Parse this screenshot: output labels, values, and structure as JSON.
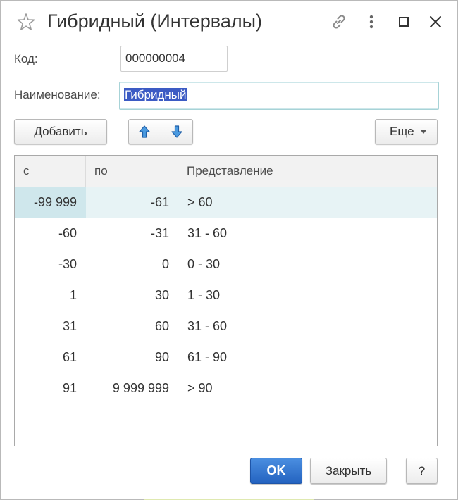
{
  "window": {
    "title": "Гибридный (Интервалы)",
    "icons": [
      "star-icon",
      "link-icon",
      "more-vertical-icon",
      "maximize-icon",
      "close-icon"
    ]
  },
  "form": {
    "code_label": "Код:",
    "code_value": "000000004",
    "name_label": "Наименование:",
    "name_value": "Гибридный"
  },
  "toolbar": {
    "add_label": "Добавить",
    "move_up_icon": "arrow-up-icon",
    "move_down_icon": "arrow-down-icon",
    "more_label": "Еще"
  },
  "table": {
    "columns": [
      "с",
      "по",
      "Представление"
    ],
    "rows": [
      [
        "-99 999",
        "-61",
        "> 60"
      ],
      [
        "-60",
        "-31",
        "31 - 60"
      ],
      [
        "-30",
        "0",
        "0 - 30"
      ],
      [
        "1",
        "30",
        "1 - 30"
      ],
      [
        "31",
        "60",
        "31 - 60"
      ],
      [
        "61",
        "90",
        "61 - 90"
      ],
      [
        "91",
        "9 999 999",
        "> 90"
      ]
    ],
    "selected_row": 0
  },
  "footer": {
    "ok_label": "OK",
    "close_label": "Закрыть",
    "help_label": "?"
  },
  "colors": {
    "primary_button": "#2f74d0",
    "selection": "#3c5bc4",
    "selected_row": "#e7f3f5"
  }
}
